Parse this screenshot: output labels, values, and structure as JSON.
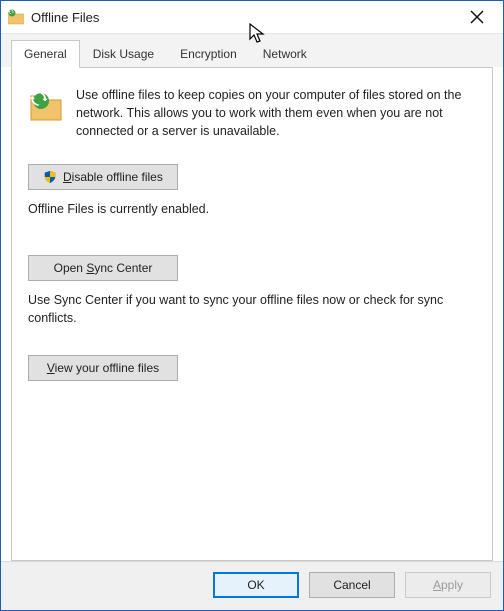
{
  "window": {
    "title": "Offline Files"
  },
  "tabs": {
    "general": "General",
    "disk_usage": "Disk Usage",
    "encryption": "Encryption",
    "network": "Network"
  },
  "general": {
    "intro": "Use offline files to keep copies on your computer of files stored on the network.  This allows you to work with them even when you are not connected or a server is unavailable.",
    "disable_lead": "D",
    "disable_rest": "isable offline files",
    "status": "Offline Files is currently enabled.",
    "sync_prefix": "Open ",
    "sync_lead": "S",
    "sync_rest": "ync Center",
    "sync_desc": "Use Sync Center if you want to sync your offline files now or check for sync conflicts.",
    "view_lead": "V",
    "view_rest": "iew your offline files"
  },
  "footer": {
    "ok": "OK",
    "cancel": "Cancel",
    "apply_lead": "A",
    "apply_rest": "pply"
  }
}
